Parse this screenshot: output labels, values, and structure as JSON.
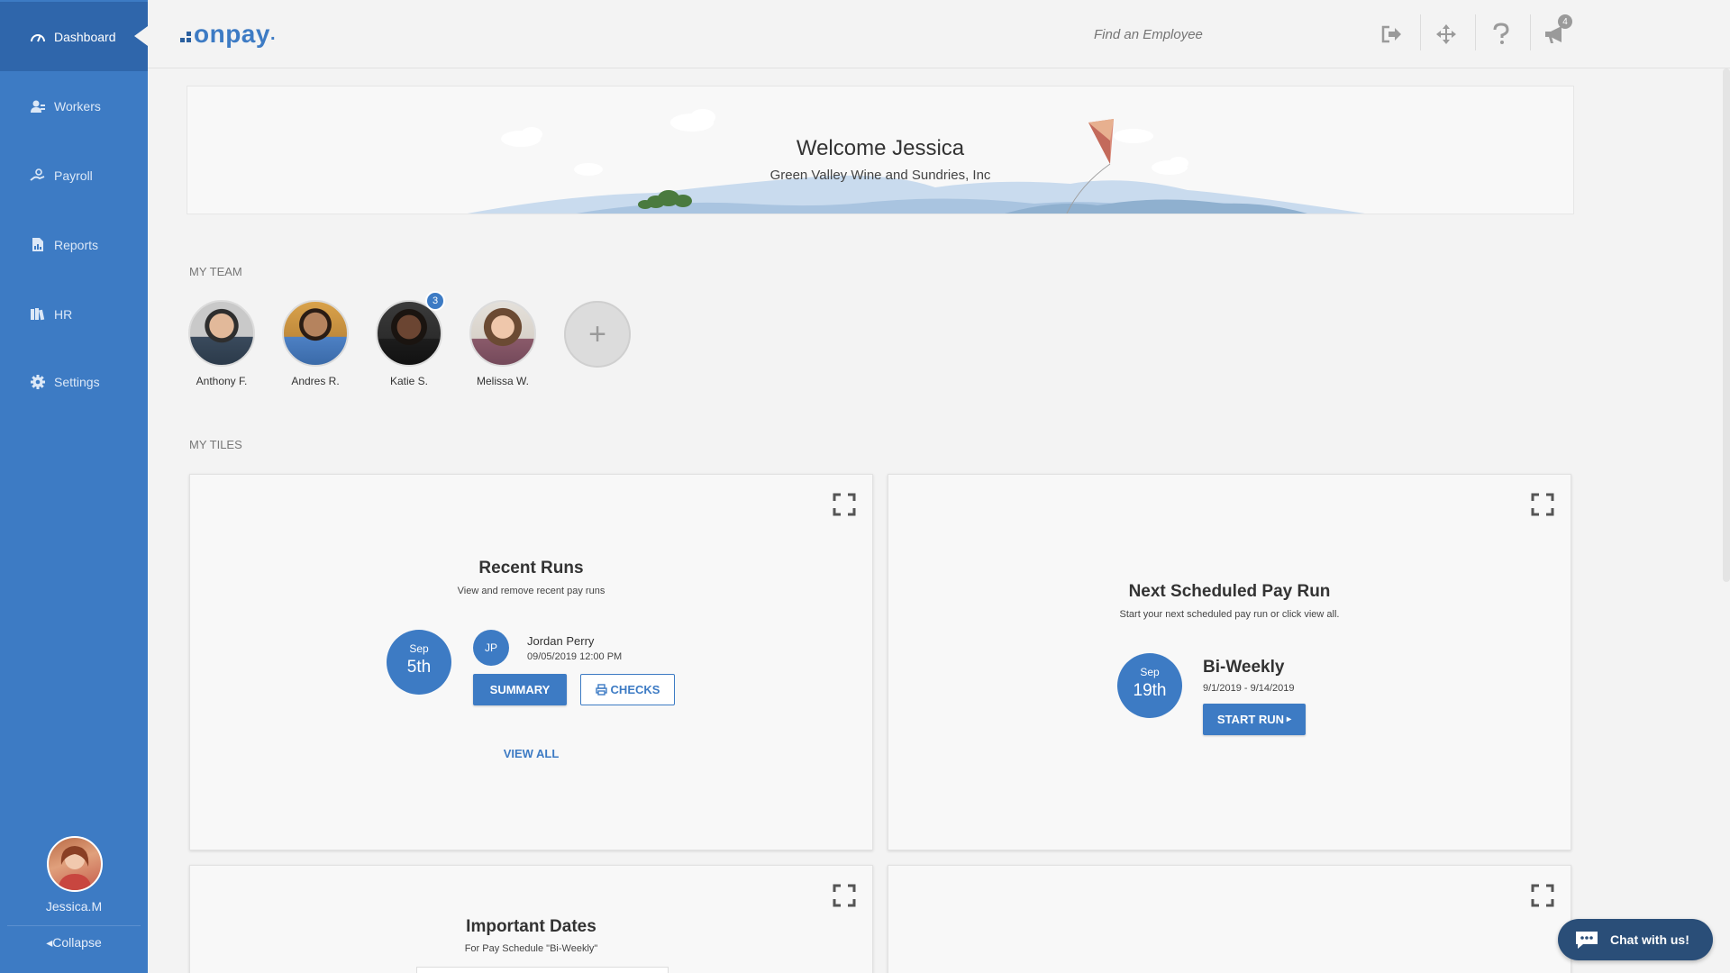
{
  "sidebar": {
    "items": [
      {
        "label": "Dashboard",
        "icon": "gauge-icon",
        "active": true
      },
      {
        "label": "Workers",
        "icon": "workers-icon"
      },
      {
        "label": "Payroll",
        "icon": "payroll-hand-icon"
      },
      {
        "label": "Reports",
        "icon": "report-document-icon"
      },
      {
        "label": "HR",
        "icon": "books-icon"
      },
      {
        "label": "Settings",
        "icon": "gear-icon"
      }
    ],
    "user_name": "Jessica.M",
    "collapse_label": "Collapse"
  },
  "topbar": {
    "logo_text": "onpay",
    "logo_mark": ".",
    "search_placeholder": "Find an Employee",
    "notification_count": "4"
  },
  "welcome": {
    "title": "Welcome Jessica",
    "subtitle": "Green Valley Wine and Sundries, Inc"
  },
  "team": {
    "label": "MY TEAM",
    "members": [
      {
        "name": "Anthony F.",
        "badge": ""
      },
      {
        "name": "Andres R.",
        "badge": ""
      },
      {
        "name": "Katie S.",
        "badge": "3"
      },
      {
        "name": "Melissa W.",
        "badge": ""
      }
    ],
    "add_label": "+"
  },
  "tiles": {
    "label": "MY TILES",
    "recent_runs": {
      "title": "Recent Runs",
      "subtitle": "View and remove recent pay runs",
      "month": "Sep",
      "day": "5th",
      "initials": "JP",
      "person": "Jordan Perry",
      "datetime": "09/05/2019 12:00 PM",
      "summary_label": "SUMMARY",
      "checks_label": "CHECKS",
      "view_all_label": "VIEW ALL"
    },
    "next_pay_run": {
      "title": "Next Scheduled Pay Run",
      "subtitle": "Start your next scheduled pay run or click view all.",
      "month": "Sep",
      "day": "19th",
      "schedule": "Bi-Weekly",
      "period": "9/1/2019 - 9/14/2019",
      "start_label": "START RUN"
    },
    "important_dates": {
      "title": "Important Dates",
      "subtitle": "For Pay Schedule \"Bi-Weekly\""
    }
  },
  "chat": {
    "label": "Chat with us!"
  },
  "colors": {
    "brand": "#3d7bc4",
    "sidebar_active": "#2f66ab",
    "chat": "#2a4e78"
  }
}
